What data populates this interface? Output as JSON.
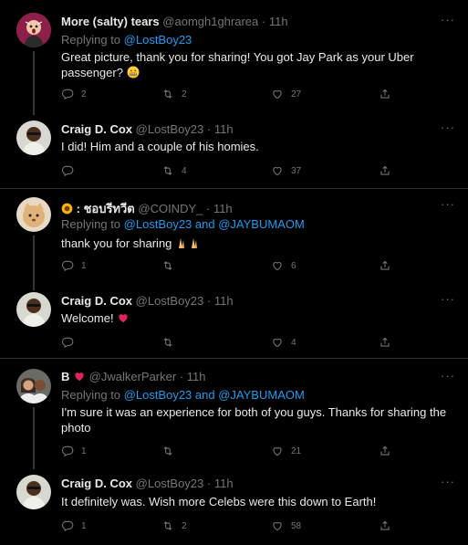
{
  "tweets": [
    {
      "name": "More (salty) tears",
      "handle": "@aomgh1ghrarea",
      "time": "· 11h",
      "replying_prefix": "Replying to ",
      "replying_to": "@LostBoy23",
      "replying_and": "",
      "replying_to2": "",
      "text": "Great picture, thank you for sharing! You got Jay Park as your Uber passenger?",
      "reply_count": "2",
      "retweet_count": "2",
      "like_count": "27"
    },
    {
      "name": "Craig D. Cox",
      "handle": "@LostBoy23",
      "time": "· 11h",
      "text": "I did! Him and a couple of his homies.",
      "reply_count": "",
      "retweet_count": "4",
      "like_count": "37"
    },
    {
      "name": ": ชอบรีทวีต",
      "handle": "@COINDY_",
      "time": "· 11h",
      "replying_prefix": "Replying to ",
      "replying_to": "@LostBoy23",
      "replying_and": " and ",
      "replying_to2": "@JAYBUMAOM",
      "text": "thank you for sharing",
      "reply_count": "1",
      "retweet_count": "",
      "like_count": "6"
    },
    {
      "name": "Craig D. Cox",
      "handle": "@LostBoy23",
      "time": "· 11h",
      "text": "Welcome!",
      "reply_count": "",
      "retweet_count": "",
      "like_count": "4"
    },
    {
      "name": "B",
      "handle": "@JwalkerParker",
      "time": "· 11h",
      "replying_prefix": "Replying to ",
      "replying_to": "@LostBoy23",
      "replying_and": " and ",
      "replying_to2": "@JAYBUMAOM",
      "text": "I'm sure it was an experience for both of you guys. Thanks for sharing the photo",
      "reply_count": "1",
      "retweet_count": "",
      "like_count": "21"
    },
    {
      "name": "Craig D. Cox",
      "handle": "@LostBoy23",
      "time": "· 11h",
      "text": "It definitely was. Wish more Celebs were this down to Earth!",
      "reply_count": "1",
      "retweet_count": "2",
      "like_count": "58"
    }
  ],
  "more_label": "···",
  "colors": {
    "accent": "#1d9bf0",
    "muted": "#71767b",
    "heart": "#f91880"
  }
}
